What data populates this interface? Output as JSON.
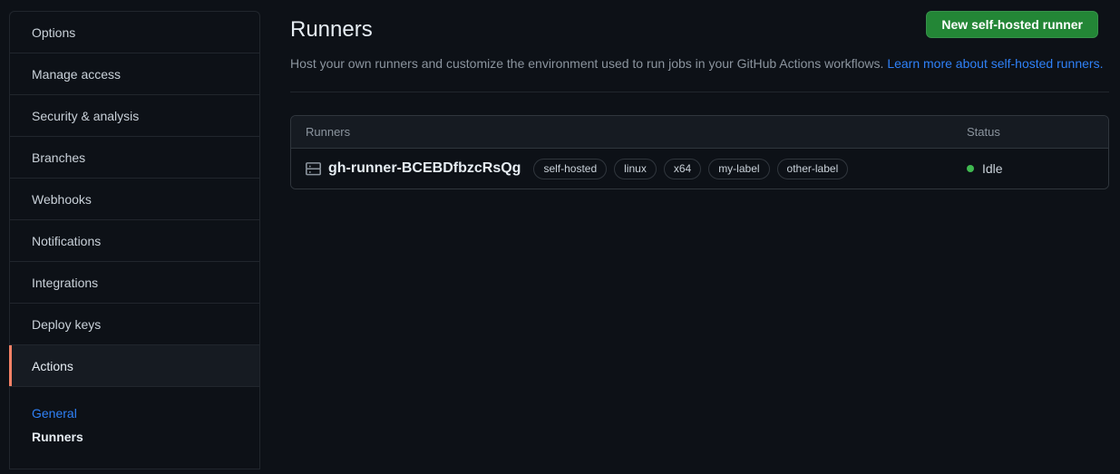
{
  "sidebar": {
    "items": [
      {
        "label": "Options",
        "active": false
      },
      {
        "label": "Manage access",
        "active": false
      },
      {
        "label": "Security & analysis",
        "active": false
      },
      {
        "label": "Branches",
        "active": false
      },
      {
        "label": "Webhooks",
        "active": false
      },
      {
        "label": "Notifications",
        "active": false
      },
      {
        "label": "Integrations",
        "active": false
      },
      {
        "label": "Deploy keys",
        "active": false
      },
      {
        "label": "Actions",
        "active": true
      }
    ],
    "subnav": [
      {
        "label": "General",
        "state": "link"
      },
      {
        "label": "Runners",
        "state": "current"
      }
    ]
  },
  "header": {
    "title": "Runners",
    "description_prefix": "Host your own runners and customize the environment used to run jobs in your GitHub Actions workflows. ",
    "learn_more_link": "Learn more about self-hosted runners.",
    "new_runner_button": "New self-hosted runner"
  },
  "runners_table": {
    "columns": {
      "name": "Runners",
      "status": "Status"
    },
    "rows": [
      {
        "icon": "server-icon",
        "name": "gh-runner-BCEBDfbzcRsQg",
        "labels": [
          "self-hosted",
          "linux",
          "x64",
          "my-label",
          "other-label"
        ],
        "status": "Idle",
        "status_color": "#3fb950"
      }
    ]
  },
  "colors": {
    "page_background": "#0d1117",
    "surface": "#161b22",
    "border": "#30363d",
    "border_muted": "#21262d",
    "text_primary": "#e6edf3",
    "text_muted": "#8b949e",
    "accent_link": "#2f81f7",
    "accent_active_border": "#f78166",
    "button_green": "#238636",
    "status_green": "#3fb950"
  }
}
